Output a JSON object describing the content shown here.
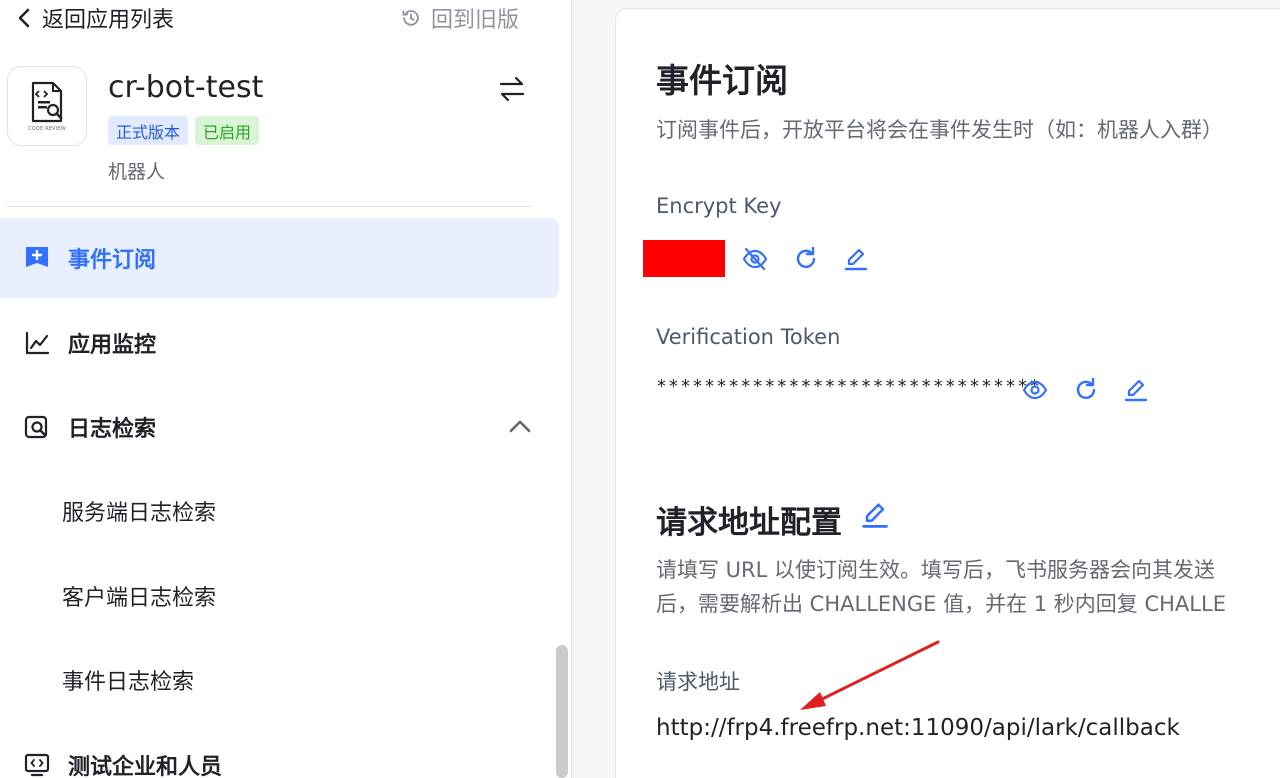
{
  "header": {
    "back_label": "返回应用列表",
    "old_version_label": "回到旧版"
  },
  "app": {
    "logo_caption": "CODE REVIEW",
    "name": "cr-bot-test",
    "badge_version": "正式版本",
    "badge_status": "已启用",
    "type": "机器人"
  },
  "sidebar": {
    "items": [
      {
        "label": "事件订阅",
        "icon": "event-subscription-icon",
        "active": true
      },
      {
        "label": "应用监控",
        "icon": "line-chart-icon"
      },
      {
        "label": "日志检索",
        "icon": "log-search-icon",
        "expanded": true
      },
      {
        "label": "服务端日志检索"
      },
      {
        "label": "客户端日志检索"
      },
      {
        "label": "事件日志检索"
      },
      {
        "label": "测试企业和人员",
        "icon": "code-monitor-icon"
      }
    ]
  },
  "main": {
    "title": "事件订阅",
    "description": "订阅事件后，开放平台将会在事件发生时（如：机器人入群）",
    "encrypt_key": {
      "label": "Encrypt Key",
      "value_redacted": true
    },
    "verification_token": {
      "label": "Verification Token",
      "value": "********************************"
    },
    "request_config": {
      "title": "请求地址配置",
      "description_line1": "请填写 URL 以使订阅生效。填写后，飞书服务器会向其发送",
      "description_line2": "后，需要解析出 CHALLENGE 值，并在 1 秒内回复 CHALLE",
      "url_label": "请求地址",
      "url_value": "http://frp4.freefrp.net:11090/api/lark/callback"
    }
  },
  "colors": {
    "accent": "#3370ff",
    "active_bg": "#e8effe",
    "redaction": "#ff0000",
    "annotation_arrow": "#e02020",
    "badge_blue_bg": "#e1eaff",
    "badge_green_bg": "#d9f5d6"
  }
}
